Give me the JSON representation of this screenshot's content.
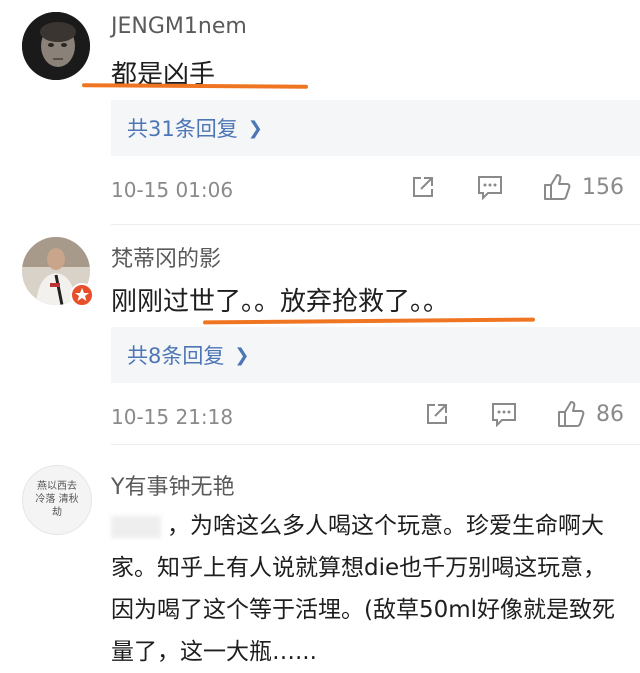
{
  "comments": [
    {
      "username": "JENGM1nem",
      "text": "都是凶手",
      "replies_label": "共31条回复",
      "timestamp": "10-15 01:06",
      "likes": "156"
    },
    {
      "username": "梵蒂冈的影",
      "text": "刚刚过世了。。放弃抢救了。。",
      "replies_label": "共8条回复",
      "timestamp": "10-15 21:18",
      "likes": "86"
    },
    {
      "username": "Y有事钟无艳",
      "avatar_text": "燕以西去 冷落 清秋 劫",
      "text": "，为啥这么多人喝这个玩意。珍爱生命啊大家。知乎上有人说就算想die也千万别喝这玩意，因为喝了这个等于活埋。(敌草50ml好像就是致死量了，这一大瓶…..."
    }
  ],
  "colors": {
    "accent_underline": "#f07522",
    "reply_link": "#4d76b5",
    "reply_bg": "#f5f6f8",
    "meta_gray": "#8a8a8a"
  },
  "icons": [
    "share-icon",
    "comment-icon",
    "thumbs-up-icon",
    "chevron-right-icon"
  ]
}
